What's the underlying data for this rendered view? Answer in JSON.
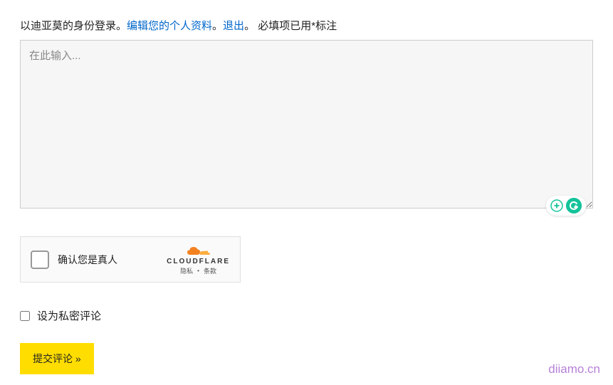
{
  "login": {
    "prefix": "以迪亚莫的身份登录。",
    "edit_profile_link": "编辑您的个人资料",
    "separator1": "。",
    "logout_link": "退出",
    "separator2": "。",
    "required_note": " 必填项已用*标注"
  },
  "comment": {
    "placeholder": "在此输入..."
  },
  "captcha": {
    "label": "确认您是真人",
    "brand": "CLOUDFLARE",
    "privacy": "隐私",
    "terms": "条款"
  },
  "private": {
    "label": "设为私密评论"
  },
  "submit": {
    "label": "提交评论 »"
  },
  "watermark": "diiamo.cn",
  "grammarly": {
    "g_letter": "G"
  }
}
